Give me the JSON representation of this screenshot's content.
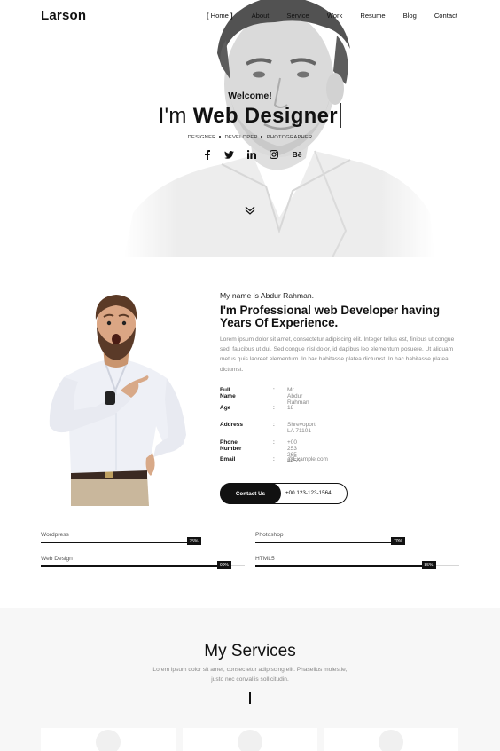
{
  "brand": "Larson",
  "nav": {
    "items": [
      "Home",
      "About",
      "Service",
      "Work",
      "Resume",
      "Blog",
      "Contact"
    ],
    "active_open": "[",
    "active_close": "]"
  },
  "hero": {
    "welcome": "Welcome!",
    "prefix": "I'm",
    "title": "Web Designer",
    "roles": [
      "DESIGNER",
      "DEVELOPER",
      "PHOTOGRAPHER"
    ],
    "social_icons": [
      "facebook-icon",
      "twitter-icon",
      "linkedin-icon",
      "instagram-icon",
      "behance-icon"
    ],
    "social_glyphs": [
      "f",
      "",
      "in",
      "",
      "Bē"
    ]
  },
  "about": {
    "intro": "My name is Abdur Rahman.",
    "title": "I'm Professional web Developer having Years Of Experience.",
    "text": "Lorem ipsum dolor sit amet, consectetur adipiscing elit. Integer tellus est, finibus ut congue sed, faucibus ut dui. Sed congue nisl dolor, id dapibus leo elementum posuere. Ut aliquam metus quis laoreet elementum. In hac habitasse platea dictumst. In hac habitasse platea dictumst.",
    "info": [
      {
        "label": "Full Name",
        "sep": ":",
        "value": "Mr. Abdur Rahman"
      },
      {
        "label": "Age",
        "sep": ":",
        "value": "18"
      },
      {
        "label": "Address",
        "sep": ":",
        "value": "Shrevoport, LA 71101"
      },
      {
        "label": "Phone Number",
        "sep": ":",
        "value": "+00 253 265 4455"
      },
      {
        "label": "Email",
        "sep": ":",
        "value": "@Example.com"
      }
    ],
    "contact_label": "Contact Us",
    "contact_phone": "+00 123-123-1564"
  },
  "skills": [
    {
      "name": "Wordpress",
      "percent": 75,
      "label": "75%"
    },
    {
      "name": "Photoshop",
      "percent": 70,
      "label": "70%"
    },
    {
      "name": "Web Design",
      "percent": 90,
      "label": "90%"
    },
    {
      "name": "HTML5",
      "percent": 85,
      "label": "85%"
    }
  ],
  "services": {
    "title": "My Services",
    "text": "Lorem ipsum dolor sit amet, consectetur adipiscing elit. Phasellus molestie, justo nec convallis sollicitudin."
  },
  "colors": {
    "accent": "#111111",
    "muted_text": "#888888",
    "services_bg": "#f7f7f7"
  }
}
